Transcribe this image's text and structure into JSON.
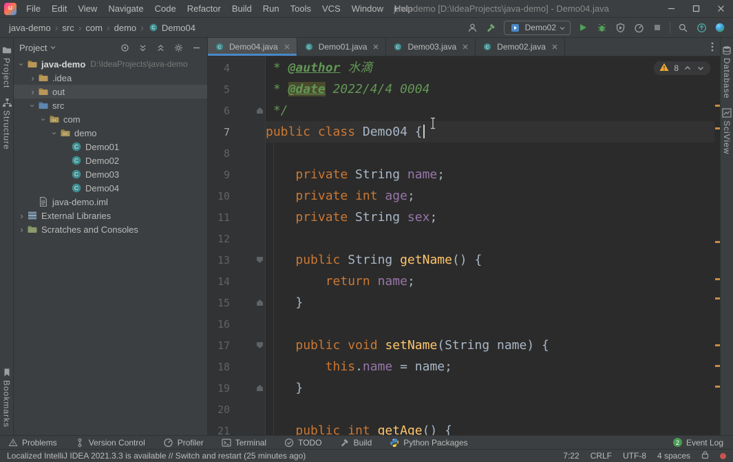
{
  "window": {
    "title": "java-demo [D:\\IdeaProjects\\java-demo] - Demo04.java",
    "controls": [
      "minimize",
      "maximize",
      "close"
    ]
  },
  "menu": {
    "items": [
      "File",
      "Edit",
      "View",
      "Navigate",
      "Code",
      "Refactor",
      "Build",
      "Run",
      "Tools",
      "VCS",
      "Window",
      "Help"
    ]
  },
  "navbar": {
    "breadcrumbs": [
      "java-demo",
      "src",
      "com",
      "demo",
      "Demo04"
    ],
    "icons_pre": [
      "user",
      "hammer"
    ],
    "run_config": "Demo02",
    "icons_run": [
      "run",
      "debug",
      "coverage",
      "profiler",
      "stop"
    ],
    "icons_right": [
      "search",
      "update",
      "sphere"
    ]
  },
  "left_stripe": {
    "top": [
      {
        "icon": "project",
        "label": "Project"
      },
      {
        "icon": "structure",
        "label": "Structure"
      }
    ],
    "bottom": [
      {
        "icon": "bookmarks",
        "label": "Bookmarks"
      }
    ]
  },
  "right_stripe": {
    "top": [
      {
        "icon": "database",
        "label": "Database"
      },
      {
        "icon": "sciview",
        "label": "SciView"
      }
    ]
  },
  "project": {
    "title": "Project",
    "header_icons": [
      "locate",
      "expand-all",
      "collapse-all",
      "settings",
      "hide"
    ],
    "tree": [
      {
        "depth": 0,
        "arrow": "open",
        "icon": "folder",
        "label": "java-demo",
        "path": "D:\\IdeaProjects\\java-demo",
        "bold": true
      },
      {
        "depth": 1,
        "arrow": "closed",
        "icon": "folder",
        "label": ".idea"
      },
      {
        "depth": 1,
        "arrow": "closed",
        "icon": "folder",
        "label": "out",
        "selected": true
      },
      {
        "depth": 1,
        "arrow": "open",
        "icon": "folder-src",
        "label": "src"
      },
      {
        "depth": 2,
        "arrow": "open",
        "icon": "package",
        "label": "com"
      },
      {
        "depth": 3,
        "arrow": "open",
        "icon": "package",
        "label": "demo"
      },
      {
        "depth": 4,
        "arrow": "none",
        "icon": "class",
        "label": "Demo01"
      },
      {
        "depth": 4,
        "arrow": "none",
        "icon": "class",
        "label": "Demo02"
      },
      {
        "depth": 4,
        "arrow": "none",
        "icon": "class",
        "label": "Demo03"
      },
      {
        "depth": 4,
        "arrow": "none",
        "icon": "class",
        "label": "Demo04"
      },
      {
        "depth": 1,
        "arrow": "none",
        "icon": "iml",
        "label": "java-demo.iml"
      },
      {
        "depth": 0,
        "arrow": "closed",
        "icon": "libs",
        "label": "External Libraries"
      },
      {
        "depth": 0,
        "arrow": "closed",
        "icon": "scratches",
        "label": "Scratches and Consoles"
      }
    ]
  },
  "tabs": {
    "items": [
      {
        "label": "Demo04.java",
        "active": true
      },
      {
        "label": "Demo01.java",
        "active": false
      },
      {
        "label": "Demo03.java",
        "active": false
      },
      {
        "label": "Demo02.java",
        "active": false
      }
    ]
  },
  "editor": {
    "warning_count": "8",
    "current_line": 7,
    "scroll_marks": [
      70,
      103,
      268,
      322,
      350,
      418,
      448,
      478
    ],
    "lines": [
      {
        "n": 4,
        "seg": [
          [
            " * ",
            "cmt"
          ],
          [
            "@author",
            "tag"
          ],
          [
            " 水滴",
            "cmt"
          ]
        ]
      },
      {
        "n": 5,
        "seg": [
          [
            " * ",
            "cmt"
          ],
          [
            "@date",
            "tag hl"
          ],
          [
            " 2022/4/4 0004",
            "cmt"
          ]
        ]
      },
      {
        "n": 6,
        "seg": [
          [
            " */",
            "cmt"
          ]
        ],
        "fold": "up"
      },
      {
        "n": 7,
        "seg": [
          [
            "public",
            "kw"
          ],
          [
            " ",
            "pln"
          ],
          [
            "class",
            "kw"
          ],
          [
            " Demo04 ",
            "pln"
          ],
          [
            "{",
            "pln"
          ]
        ],
        "caret": true
      },
      {
        "n": 8,
        "seg": []
      },
      {
        "n": 9,
        "seg": [
          [
            "    ",
            "pln"
          ],
          [
            "private",
            "kw"
          ],
          [
            " String ",
            "pln"
          ],
          [
            "name",
            "fld"
          ],
          [
            ";",
            "pln"
          ]
        ]
      },
      {
        "n": 10,
        "seg": [
          [
            "    ",
            "pln"
          ],
          [
            "private",
            "kw"
          ],
          [
            " ",
            "pln"
          ],
          [
            "int",
            "kw"
          ],
          [
            " ",
            "pln"
          ],
          [
            "age",
            "fld"
          ],
          [
            ";",
            "pln"
          ]
        ]
      },
      {
        "n": 11,
        "seg": [
          [
            "    ",
            "pln"
          ],
          [
            "private",
            "kw"
          ],
          [
            " String ",
            "pln"
          ],
          [
            "sex",
            "fld"
          ],
          [
            ";",
            "pln"
          ]
        ]
      },
      {
        "n": 12,
        "seg": []
      },
      {
        "n": 13,
        "seg": [
          [
            "    ",
            "pln"
          ],
          [
            "public",
            "kw"
          ],
          [
            " String ",
            "pln"
          ],
          [
            "getName",
            "mth"
          ],
          [
            "() {",
            "pln"
          ]
        ],
        "fold": "down"
      },
      {
        "n": 14,
        "seg": [
          [
            "        ",
            "pln"
          ],
          [
            "return",
            "kw"
          ],
          [
            " ",
            "pln"
          ],
          [
            "name",
            "fld"
          ],
          [
            ";",
            "pln"
          ]
        ]
      },
      {
        "n": 15,
        "seg": [
          [
            "    }",
            "pln"
          ]
        ],
        "fold": "up"
      },
      {
        "n": 16,
        "seg": []
      },
      {
        "n": 17,
        "seg": [
          [
            "    ",
            "pln"
          ],
          [
            "public",
            "kw"
          ],
          [
            " ",
            "pln"
          ],
          [
            "void",
            "kw"
          ],
          [
            " ",
            "pln"
          ],
          [
            "setName",
            "mth"
          ],
          [
            "(String name) {",
            "pln"
          ]
        ],
        "fold": "down"
      },
      {
        "n": 18,
        "seg": [
          [
            "        ",
            "pln"
          ],
          [
            "this",
            "kw"
          ],
          [
            ".",
            "pln"
          ],
          [
            "name",
            "fld"
          ],
          [
            " = name;",
            "pln"
          ]
        ]
      },
      {
        "n": 19,
        "seg": [
          [
            "    }",
            "pln"
          ]
        ],
        "fold": "up"
      },
      {
        "n": 20,
        "seg": []
      },
      {
        "n": 21,
        "seg": [
          [
            "    ",
            "pln"
          ],
          [
            "public",
            "kw"
          ],
          [
            " ",
            "pln"
          ],
          [
            "int",
            "kw"
          ],
          [
            " ",
            "pln"
          ],
          [
            "getAge",
            "mth"
          ],
          [
            "() {",
            "pln"
          ]
        ]
      }
    ]
  },
  "bottom_bar": {
    "items": [
      {
        "icon": "problems",
        "label": "Problems"
      },
      {
        "icon": "vcs",
        "label": "Version Control"
      },
      {
        "icon": "profiler",
        "label": "Profiler"
      },
      {
        "icon": "terminal",
        "label": "Terminal"
      },
      {
        "icon": "todo",
        "label": "TODO"
      },
      {
        "icon": "build",
        "label": "Build"
      },
      {
        "icon": "python",
        "label": "Python Packages"
      }
    ],
    "event_log": {
      "label": "Event Log",
      "badge": "2"
    }
  },
  "status_bar": {
    "message": "Localized IntelliJ IDEA 2021.3.3 is available // Switch and restart (25 minutes ago)",
    "items": [
      "7:22",
      "CRLF",
      "UTF-8",
      "4 spaces"
    ]
  },
  "colors": {
    "accent": "#4A88C7",
    "warning": "#F0A732",
    "run_green": "#4FA158",
    "error_stripe": "#C98C45"
  }
}
